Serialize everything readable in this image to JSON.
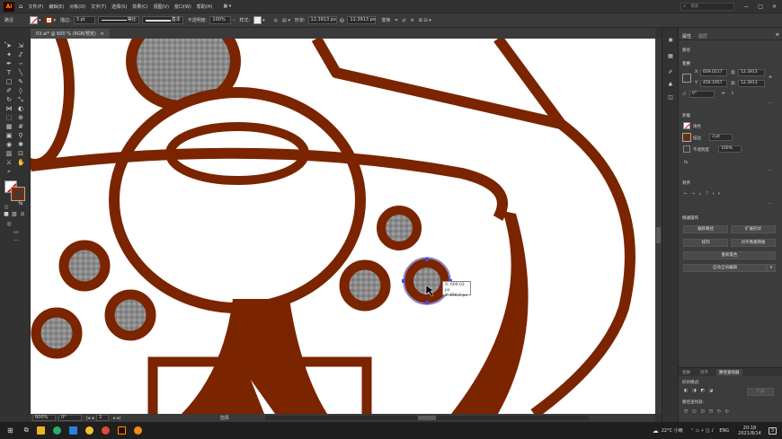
{
  "app": {
    "logo": "Ai",
    "title": "Adobe Illustrator"
  },
  "menu": [
    "文件(F)",
    "编辑(E)",
    "对象(O)",
    "文字(T)",
    "选择(S)",
    "效果(C)",
    "视图(V)",
    "窗口(W)",
    "帮助(H)"
  ],
  "window_controls": {
    "search_placeholder": "搜索",
    "minimize": "—",
    "maximize": "□",
    "close": "✕"
  },
  "control_bar": {
    "context": "路径",
    "stroke_label": "描边:",
    "stroke_value": "3 pt",
    "uniform_label": "等比",
    "basic_label": "基本",
    "opacity_label": "不透明度:",
    "opacity_value": "100%",
    "style_label": "样式:",
    "shape_label": "形状:",
    "w_value": "12.3913 px",
    "h_value": "12.3913 px",
    "transform_label": "变换",
    "fill_color": "#ffffff",
    "stroke_color": "#7a2c04"
  },
  "document_tab": "03.ai* @ 600 % (RGB/预览)",
  "status_bar": {
    "zoom": "600%",
    "angle": "0°",
    "artboard": "1",
    "mode": "选择"
  },
  "tooltip": {
    "x": "X: 609.02 px",
    "y": "Y: 456.2 px"
  },
  "panel": {
    "tabs": [
      "属性",
      "图层"
    ],
    "tab_selected": "属性",
    "section_path": "路径",
    "section_transform": "变换",
    "x_label": "X:",
    "x_value": "609.0217",
    "y_label": "Y:",
    "y_value": "456.1957",
    "w_label": "宽:",
    "w_value": "12.3913",
    "h_label": "高:",
    "h_value": "12.3913",
    "angle_value": "0°",
    "section_appearance": "外观",
    "fill_label": "填色",
    "stroke_label": "描边",
    "stroke_value": "3 pt",
    "opacity_label": "不透明度",
    "opacity_value": "100%",
    "fx_label": "fx.",
    "section_align": "对齐",
    "section_quick": "快速操作",
    "btn_offset": "偏移路径",
    "btn_expand": "扩展形状",
    "btn_arrange": "排列",
    "btn_align_grid": "对齐像素网格",
    "btn_recolor": "重新着色",
    "btn_global_edit": "启动全局编辑",
    "pathfinder_tabs": [
      "变换",
      "对齐",
      "路径查找器"
    ],
    "shape_mode_label": "形状模式:",
    "expand_btn": "扩展",
    "pathfinder_label": "路径查找器:"
  },
  "taskbar": {
    "weather": "22°C 小雨",
    "lang": "ENG",
    "time": "20:18",
    "date": "2021/8/14",
    "notifications": "3"
  },
  "colors": {
    "art_brown": "#7a2400",
    "art_gray": "#8a8a8a",
    "canvas": "#ffffff",
    "ui_dark": "#323232",
    "selection": "#4b4bd6"
  }
}
